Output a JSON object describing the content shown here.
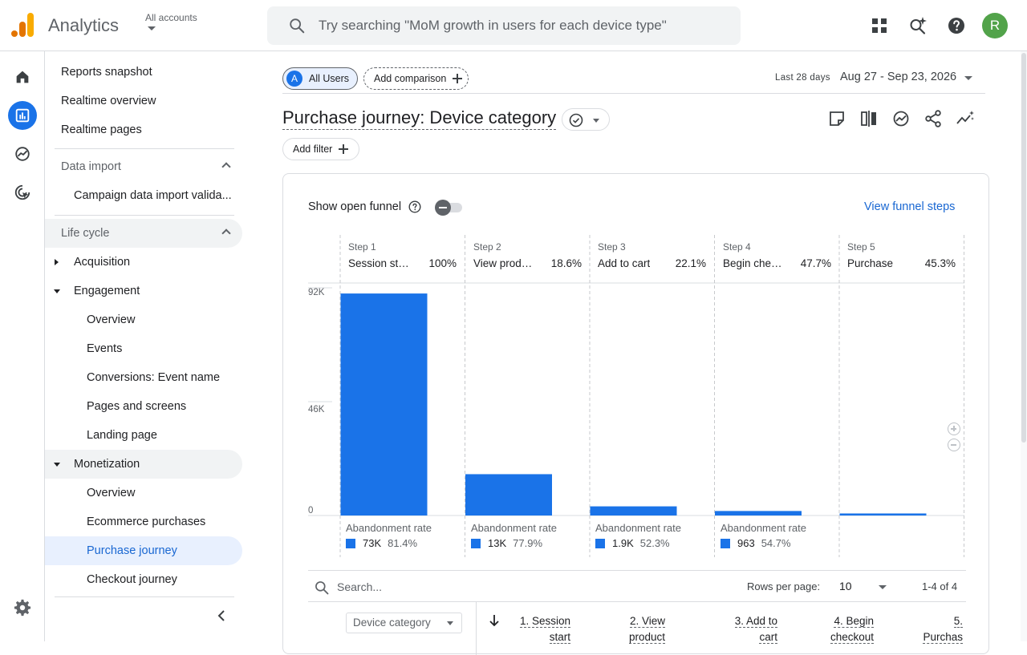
{
  "topbar": {
    "app_name": "Analytics",
    "account_label": "All accounts",
    "search_placeholder": "Try searching \"MoM growth in users for each device type\"",
    "avatar_initial": "R",
    "avatar_color": "#52a34a"
  },
  "nav": {
    "reports_snapshot": "Reports snapshot",
    "realtime_overview": "Realtime overview",
    "realtime_pages": "Realtime pages",
    "data_import": "Data import",
    "campaign_import": "Campaign data import valida...",
    "life_cycle": "Life cycle",
    "acquisition": "Acquisition",
    "engagement": "Engagement",
    "eng_overview": "Overview",
    "eng_events": "Events",
    "eng_conversions": "Conversions: Event name",
    "eng_pages": "Pages and screens",
    "eng_landing": "Landing page",
    "monetization": "Monetization",
    "mon_overview": "Overview",
    "mon_ecommerce": "Ecommerce purchases",
    "mon_purchase_journey": "Purchase journey",
    "mon_checkout": "Checkout journey"
  },
  "header": {
    "segment_badge": "A",
    "segment_label": "All Users",
    "add_comparison": "Add comparison",
    "date_label": "Last 28 days",
    "date_range": "Aug 27 - Sep 23, 2026",
    "page_title": "Purchase journey: Device category",
    "add_filter": "Add filter"
  },
  "card": {
    "show_open_funnel": "Show open funnel",
    "open_funnel_on": false,
    "view_funnel_steps": "View funnel steps"
  },
  "chart_data": {
    "type": "bar",
    "categories": [
      "Session start",
      "View product",
      "Add to cart",
      "Begin checkout",
      "Purchase"
    ],
    "step_labels": [
      "Step 1",
      "Step 2",
      "Step 3",
      "Step 4",
      "Step 5"
    ],
    "step_display_names": [
      "Session st…",
      "View prod…",
      "Add to cart",
      "Begin che…",
      "Purchase"
    ],
    "step_percent_labels": [
      "100%",
      "18.6%",
      "22.1%",
      "47.7%",
      "45.3%"
    ],
    "values": [
      89700,
      16700,
      3700,
      1820,
      824
    ],
    "y_ticks": [
      0,
      46000,
      92000
    ],
    "y_tick_labels": [
      "0",
      "46K",
      "92K"
    ],
    "ylim": [
      0,
      92000
    ],
    "abandonment_label": "Abandonment rate",
    "abandonment_counts": [
      "73K",
      "13K",
      "1.9K",
      "963"
    ],
    "abandonment_rates": [
      "81.4%",
      "77.9%",
      "52.3%",
      "54.7%"
    ],
    "bar_color": "#1a73e8",
    "grid": true
  },
  "table": {
    "search_placeholder": "Search...",
    "rows_per_page_label": "Rows per page:",
    "rows_per_page": "10",
    "paging": "1-4 of 4",
    "dimension": "Device category",
    "columns": [
      {
        "line1": "1. Session",
        "line2": "start"
      },
      {
        "line1": "2. View",
        "line2": "product"
      },
      {
        "line1": "3. Add to",
        "line2": "cart"
      },
      {
        "line1": "4. Begin",
        "line2": "checkout"
      },
      {
        "line1": "5.",
        "line2": "Purchas"
      }
    ]
  },
  "colors": {
    "accent": "#1a73e8",
    "selected_bg": "#e8f0fe",
    "selected_text": "#1967d2"
  }
}
